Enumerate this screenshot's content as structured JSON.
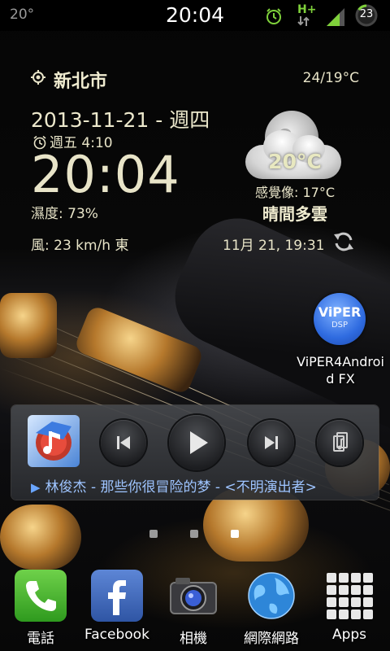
{
  "status_bar": {
    "left_temp": "20°",
    "time": "20:04",
    "network": "H+",
    "battery": "23",
    "icons": [
      "alarm-icon",
      "network-hplus-icon",
      "signal-icon",
      "battery-icon"
    ]
  },
  "weather": {
    "city": "新北市",
    "temp_range": "24/19°C",
    "date": "2013-11-21 - 週四",
    "alarm": "週五 4:10",
    "clock": "20:04",
    "humidity": "濕度: 73%",
    "wind": "風: 23 km/h 東",
    "current_temp": "20°C",
    "feels_like": "感覺像: 17°C",
    "condition": "晴間多雲",
    "updated": "11月 21, 19:31",
    "icons": [
      "location-icon",
      "alarm-icon",
      "moon-cloud-icon",
      "refresh-icon"
    ]
  },
  "apps": {
    "viper_logo": "ViPER",
    "viper_sub": "DSP",
    "viper_label_1": "ViPER4Androi",
    "viper_label_2": "d FX"
  },
  "player": {
    "track": "林俊杰 - 那些你很冒险的梦 - <不明演出者>",
    "controls": [
      "previous-icon",
      "play-icon",
      "next-icon",
      "playlist-icon"
    ]
  },
  "pages": {
    "count": 3,
    "active_index": 2
  },
  "dock": [
    {
      "label": "電話",
      "icon": "phone-icon"
    },
    {
      "label": "Facebook",
      "icon": "facebook-icon"
    },
    {
      "label": "相機",
      "icon": "camera-icon"
    },
    {
      "label": "網際網路",
      "icon": "globe-icon"
    },
    {
      "label": "Apps",
      "icon": "apps-grid-icon"
    }
  ],
  "colors": {
    "widget_text": "#e8e4c8",
    "accent_blue": "#6aa6ff",
    "status_green": "#7fd13b"
  }
}
